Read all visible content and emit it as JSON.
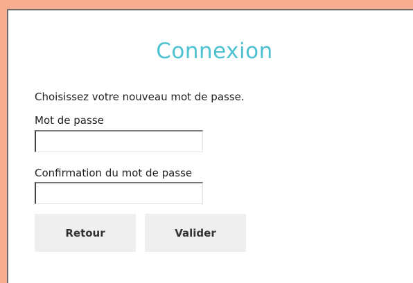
{
  "form": {
    "title": "Connexion",
    "instruction": "Choisissez votre nouveau mot de passe.",
    "password_label": "Mot de passe",
    "password_value": "",
    "password_placeholder": "",
    "confirm_label": "Confirmation du mot de passe",
    "confirm_value": "",
    "confirm_placeholder": "",
    "back_button": "Retour",
    "submit_button": "Valider"
  },
  "colors": {
    "page_background": "#f7ad8f",
    "title": "#4ec1d1",
    "button_background": "#efefef"
  }
}
